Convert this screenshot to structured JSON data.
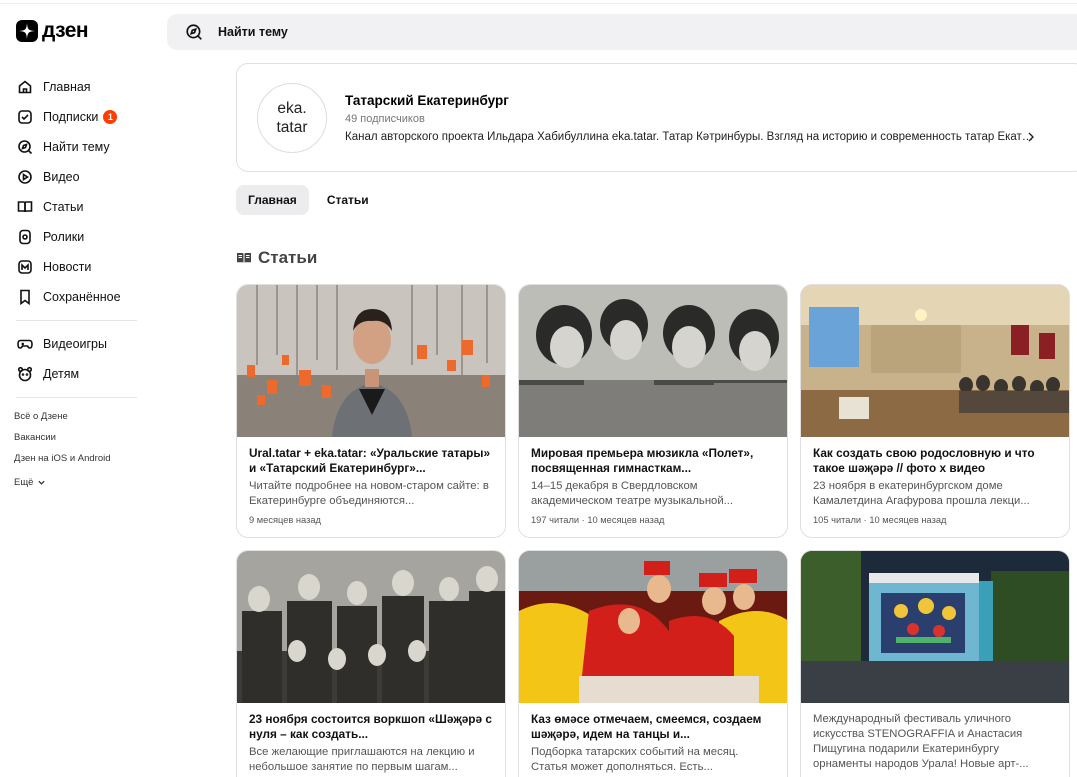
{
  "app": {
    "logo_text": "дзен"
  },
  "sidebar": {
    "items": [
      {
        "label": "Главная",
        "icon": "home-icon"
      },
      {
        "label": "Подписки",
        "icon": "subscriptions-icon",
        "badge": "1"
      },
      {
        "label": "Найти тему",
        "icon": "compass-icon"
      },
      {
        "label": "Видео",
        "icon": "video-icon"
      },
      {
        "label": "Статьи",
        "icon": "articles-icon"
      },
      {
        "label": "Ролики",
        "icon": "shorts-icon"
      },
      {
        "label": "Новости",
        "icon": "news-icon"
      },
      {
        "label": "Сохранённое",
        "icon": "bookmark-icon"
      }
    ],
    "extra_items": [
      {
        "label": "Видеоигры",
        "icon": "gamepad-icon"
      },
      {
        "label": "Детям",
        "icon": "kids-icon"
      }
    ],
    "footer": [
      "Всё о Дзене",
      "Вакансии",
      "Дзен на iOS и Android",
      "Ещё"
    ]
  },
  "search": {
    "placeholder": "Найти тему"
  },
  "channel": {
    "avatar_line1": "eka.",
    "avatar_line2": "tatar",
    "title": "Татарский Екатеринбург",
    "subscribers": "49 подписчиков",
    "description": "Канал авторского проекта Ильдара Хабибуллина eka.tatar. Татар Кәтринбуры. Взгляд на историю и современность татар Екатеринбурга"
  },
  "tabs": [
    {
      "label": "Главная",
      "active": true
    },
    {
      "label": "Статьи",
      "active": false
    }
  ],
  "section_title": "Статьи",
  "articles": [
    {
      "title": "Ural.tatar + eka.tatar: «Уральские татары» и «Татарский Екатеринбург»...",
      "desc": "Читайте подробнее на новом-старом сайте: в Екатеринбурге объединяются...",
      "meta": "9 месяцев назад"
    },
    {
      "title": "Мировая премьера мюзикла «Полет», посвященная гимнасткам...",
      "desc": "14–15 декабря в Свердловском академическом театре музыкальной...",
      "meta": "197 читали · 10 месяцев назад"
    },
    {
      "title": "Как создать свою родословную и что такое шәҗәрә // фото х видео",
      "desc": "23 ноября в екатеринбургском доме Камалетдина Агафурова прошла лекци...",
      "meta": "105 читали · 10 месяцев назад"
    },
    {
      "title": "23 ноября состоится воркшоп «Шәҗәрә с нуля – как создать...",
      "desc": "Все желающие приглашаются на лекцию и небольшое занятие по первым шагам...",
      "meta": ""
    },
    {
      "title": "Каз өмәсе отмечаем, смеемся, создаем шәҗәрә, идем на танцы и...",
      "desc": "Подборка татарских событий на месяц. Статья может дополняться. Есть...",
      "meta": ""
    },
    {
      "title": "",
      "desc": "Международный фестиваль уличного искусства STENOGRAFFIA и Анастасия Пищугина подарили Екатеринбургу орнаменты народов Урала! Новые арт-...",
      "meta": ""
    }
  ],
  "colors": {
    "badge": "#ff3d00",
    "search_bg": "#f1f1f3",
    "active_tab_bg": "#ececee"
  }
}
